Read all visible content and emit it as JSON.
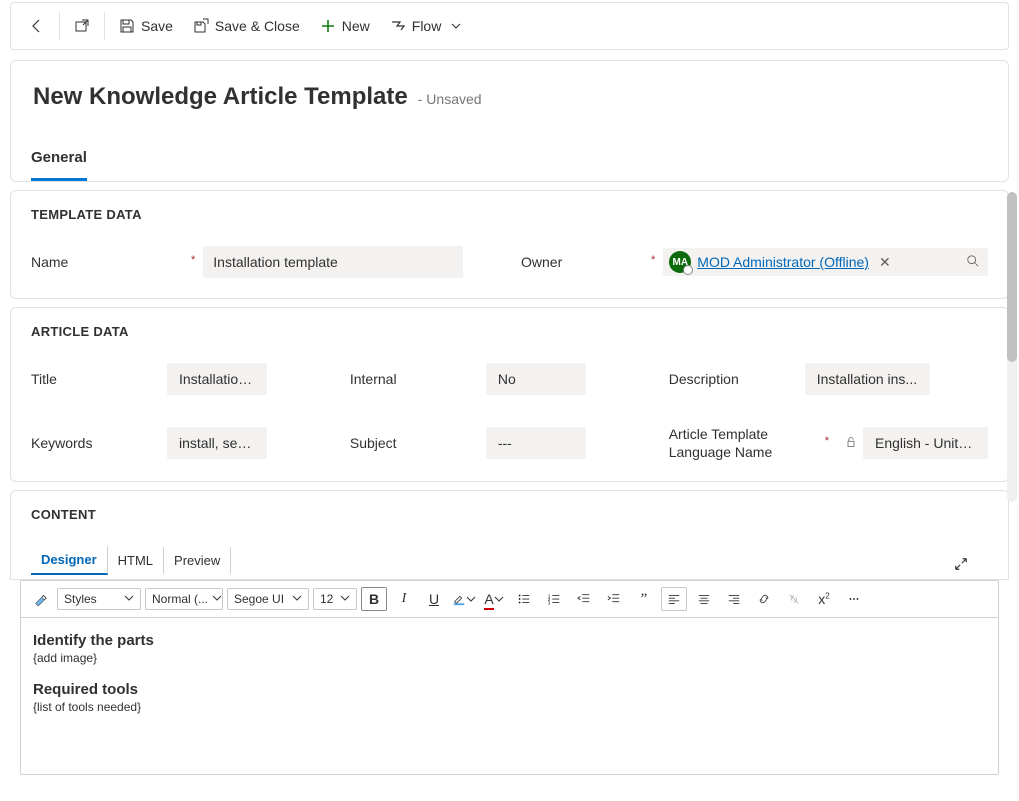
{
  "toolbar": {
    "save": "Save",
    "saveClose": "Save & Close",
    "new": "New",
    "flow": "Flow"
  },
  "header": {
    "title": "New Knowledge Article Template",
    "status": "- Unsaved"
  },
  "tabs": {
    "general": "General"
  },
  "template": {
    "sectionTitle": "TEMPLATE DATA",
    "nameLabel": "Name",
    "nameValue": "Installation template",
    "ownerLabel": "Owner",
    "ownerAvatar": "MA",
    "ownerValue": "MOD Administrator (Offline)"
  },
  "article": {
    "sectionTitle": "ARTICLE DATA",
    "titleLabel": "Title",
    "titleValue": "Installation...",
    "internalLabel": "Internal",
    "internalValue": "No",
    "descriptionLabel": "Description",
    "descriptionValue": "Installation ins...",
    "keywordsLabel": "Keywords",
    "keywordsValue": "install, set up",
    "subjectLabel": "Subject",
    "subjectValue": "---",
    "langLabel": "Article Template Language Name",
    "langValue": "English - Unite..."
  },
  "content": {
    "sectionTitle": "CONTENT",
    "innerTabs": {
      "designer": "Designer",
      "html": "HTML",
      "preview": "Preview"
    },
    "dd": {
      "styles": "Styles",
      "format": "Normal (...",
      "font": "Segoe UI",
      "size": "12"
    },
    "body": {
      "h1": "Identify the parts",
      "p1": "{add image}",
      "h2": "Required tools",
      "p2": "{list of tools needed}"
    }
  }
}
